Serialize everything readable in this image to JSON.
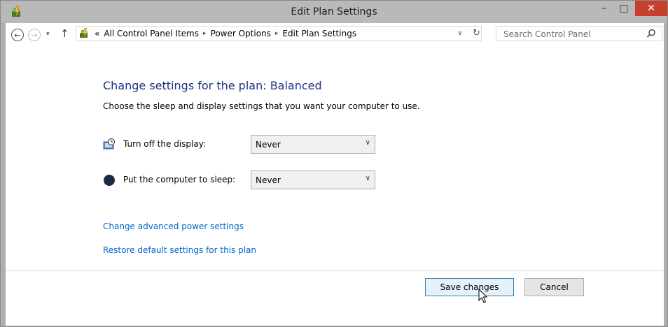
{
  "window": {
    "title": "Edit Plan Settings",
    "minimize_label": "–",
    "maximize_label": "□",
    "close_label": "✕"
  },
  "nav": {
    "back_label": "←",
    "forward_label": "→",
    "dropdown_label": "▾",
    "up_label": "↑"
  },
  "breadcrumb": {
    "overflow": "«",
    "separator": "▸",
    "items": [
      {
        "label": "All Control Panel Items"
      },
      {
        "label": "Power Options"
      },
      {
        "label": "Edit Plan Settings"
      }
    ],
    "dropdown_label": "∨",
    "refresh_label": "↻"
  },
  "search": {
    "placeholder": "Search Control Panel"
  },
  "main": {
    "heading": "Change settings for the plan: Balanced",
    "subtext": "Choose the sleep and display settings that you want your computer to use.",
    "settings": [
      {
        "label": "Turn off the display:",
        "value": "Never",
        "icon": "display-timer-icon"
      },
      {
        "label": "Put the computer to sleep:",
        "value": "Never",
        "icon": "sleep-moon-icon"
      }
    ],
    "links": [
      {
        "label": "Change advanced power settings"
      },
      {
        "label": "Restore default settings for this plan"
      }
    ]
  },
  "buttons": {
    "save": "Save changes",
    "cancel": "Cancel"
  },
  "colors": {
    "heading": "#1e3287",
    "link": "#0066cc",
    "close": "#c7402d",
    "titlebar": "#b9b9b9"
  }
}
